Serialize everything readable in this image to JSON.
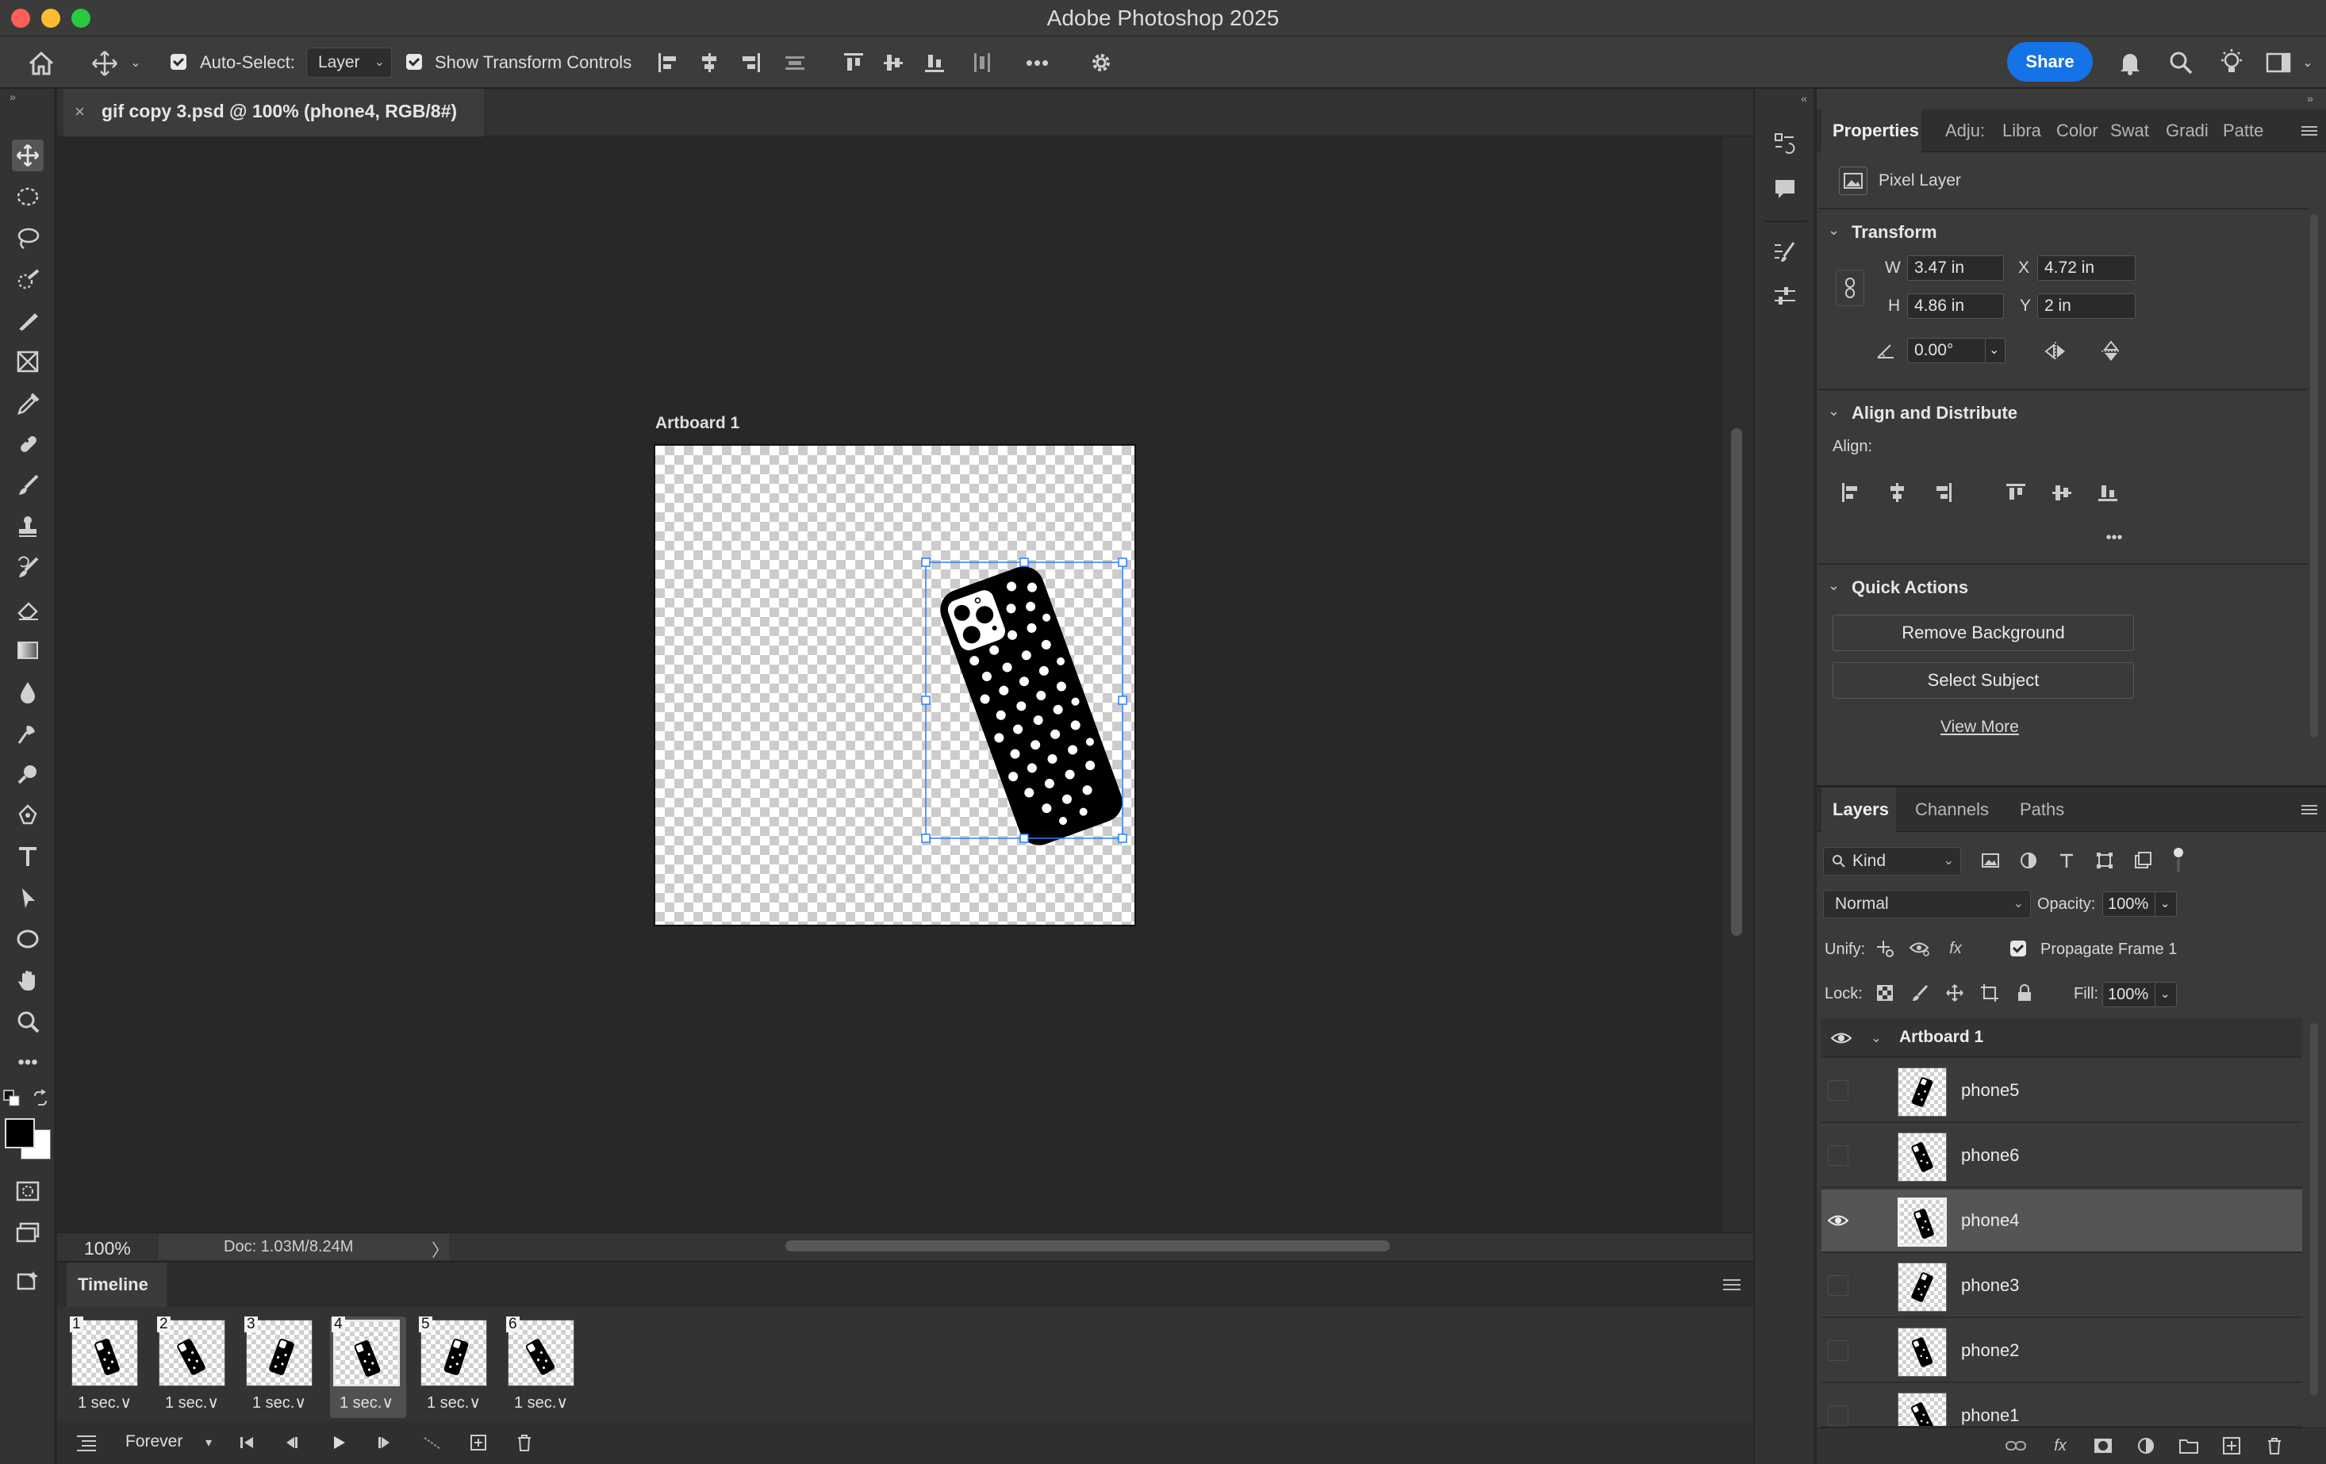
{
  "window": {
    "title": "Adobe Photoshop 2025"
  },
  "options_bar": {
    "auto_select_label": "Auto-Select:",
    "auto_select_value": "Layer",
    "show_transform_label": "Show Transform Controls",
    "share_label": "Share"
  },
  "document": {
    "tab_title": "gif copy 3.psd @ 100% (phone4, RGB/8#)",
    "artboard_label": "Artboard 1",
    "zoom": "100%",
    "doc_info": "Doc: 1.03M/8.24M"
  },
  "timeline": {
    "title": "Timeline",
    "loop": "Forever",
    "selected_frame": 4,
    "frames": [
      {
        "num": "1",
        "delay": "1 sec.∨"
      },
      {
        "num": "2",
        "delay": "1 sec.∨"
      },
      {
        "num": "3",
        "delay": "1 sec.∨"
      },
      {
        "num": "4",
        "delay": "1 sec.∨"
      },
      {
        "num": "5",
        "delay": "1 sec.∨"
      },
      {
        "num": "6",
        "delay": "1 sec.∨"
      }
    ]
  },
  "properties": {
    "tabs": [
      "Properties",
      "Adju:",
      "Libra",
      "Color",
      "Swat",
      "Gradi",
      "Patte"
    ],
    "layer_type": "Pixel Layer",
    "transform": {
      "title": "Transform",
      "w_label": "W",
      "w": "3.47 in",
      "h_label": "H",
      "h": "4.86 in",
      "x_label": "X",
      "x": "4.72 in",
      "y_label": "Y",
      "y": "2 in",
      "angle": "0.00°"
    },
    "align": {
      "title": "Align and Distribute",
      "align_label": "Align:"
    },
    "quick_actions": {
      "title": "Quick Actions",
      "remove_bg": "Remove Background",
      "select_subject": "Select Subject",
      "view_more": "View More"
    }
  },
  "layers_panel": {
    "tabs": [
      "Layers",
      "Channels",
      "Paths"
    ],
    "filter_kind": "Kind",
    "blend_mode": "Normal",
    "opacity_label": "Opacity:",
    "opacity": "100%",
    "unify_label": "Unify:",
    "propagate_label": "Propagate Frame 1",
    "lock_label": "Lock:",
    "fill_label": "Fill:",
    "fill": "100%",
    "group_name": "Artboard 1",
    "layers": [
      {
        "name": "phone5",
        "visible": false
      },
      {
        "name": "phone6",
        "visible": false
      },
      {
        "name": "phone4",
        "visible": true,
        "selected": true
      },
      {
        "name": "phone3",
        "visible": false
      },
      {
        "name": "phone2",
        "visible": false
      },
      {
        "name": "phone1",
        "visible": false
      }
    ]
  },
  "colors": {
    "accent": "#1473e6",
    "selection_box": "#2a7fff",
    "close_button": "#ff5f57",
    "minimize_button": "#febc2e",
    "zoom_button": "#28c840"
  }
}
